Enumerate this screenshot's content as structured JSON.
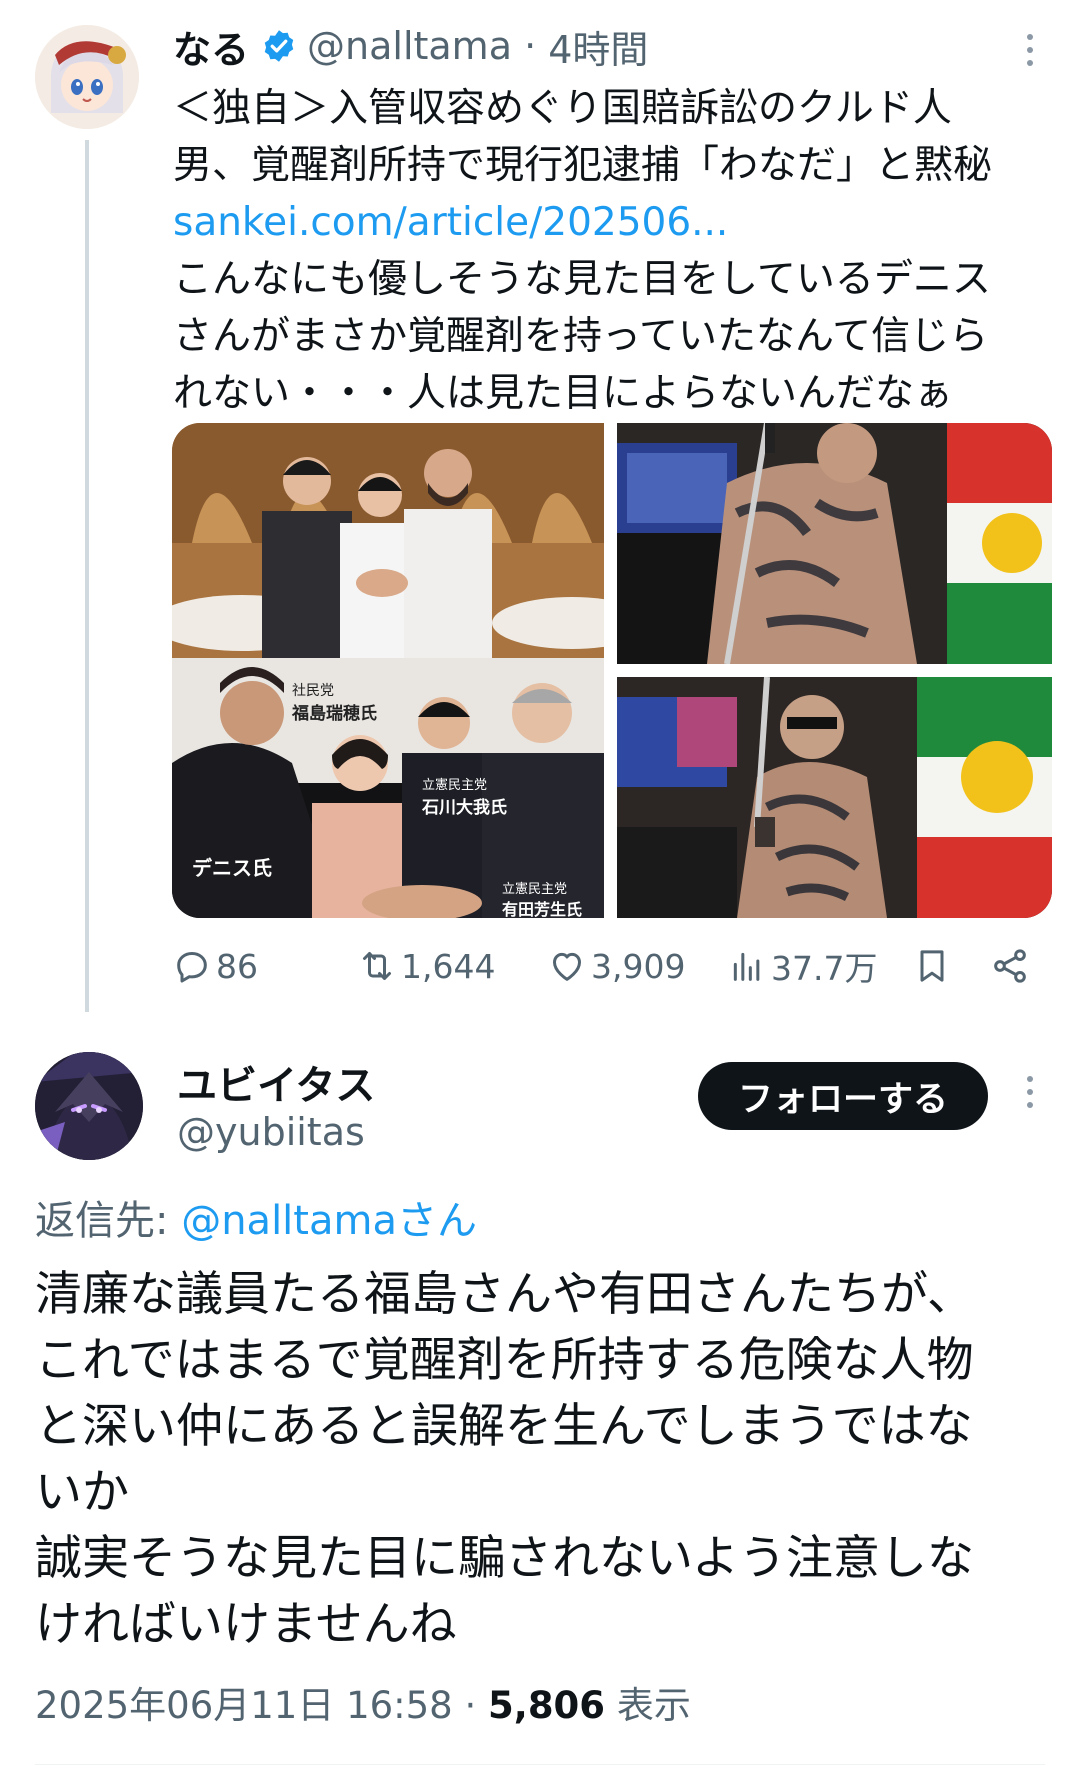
{
  "quoted_post": {
    "display_name": "なる",
    "handle": "@nalltama",
    "time": "4時間",
    "text_lines": [
      "＜独自＞入管収容めぐり国賠訴訟のクルド人",
      "男、覚醒剤所持で現行犯逮捕「わなだ」と黙秘"
    ],
    "link": "sankei.com/article/202506...",
    "comment_lines": [
      "こんなにも優しそうな見た目をしているデニス",
      "さんがまさか覚醒剤を持っていたなんて信じら",
      "れない・・・人は見た目によらないんだなぁ"
    ],
    "images": [
      {
        "icon": "photo-handshake-group"
      },
      {
        "icon": "photo-collage-handshake",
        "captions": {
          "party_1": "社民党",
          "name_1": "福島瑞穂氏",
          "person_left": "デニス氏",
          "party_2": "立憲民主党",
          "name_2": "石川大我氏",
          "party_3": "立憲民主党",
          "name_3": "有田芳生氏"
        }
      },
      {
        "icon": "photo-tattooed-man-sword"
      },
      {
        "icon": "photo-tattooed-man-flag"
      }
    ],
    "stats": {
      "replies": "86",
      "reposts": "1,644",
      "likes": "3,909",
      "views": "37.7万"
    }
  },
  "reply_post": {
    "display_name": "ユビイタス",
    "handle": "@yubiitas",
    "follow_label": "フォローする",
    "reply_prefix": "返信先: ",
    "reply_mention": "@nalltamaさん",
    "text_lines": [
      "清廉な議員たる福島さんや有田さんたちが、",
      "これではまるで覚醒剤を所持する危険な人物",
      "と深い仲にあると誤解を生んでしまうではな",
      "いか",
      "誠実そうな見た目に騙されないよう注意しな",
      "ければいけませんね"
    ],
    "timestamp": "2025年06月11日 16:58",
    "separator": " · ",
    "views_count": "5,806",
    "views_label": " 表示"
  },
  "colors": {
    "text": "#0f1419",
    "secondary": "#536471",
    "link": "#1d9bf0",
    "thread_line": "#cfd9de",
    "follow_bg": "#0f1419"
  }
}
